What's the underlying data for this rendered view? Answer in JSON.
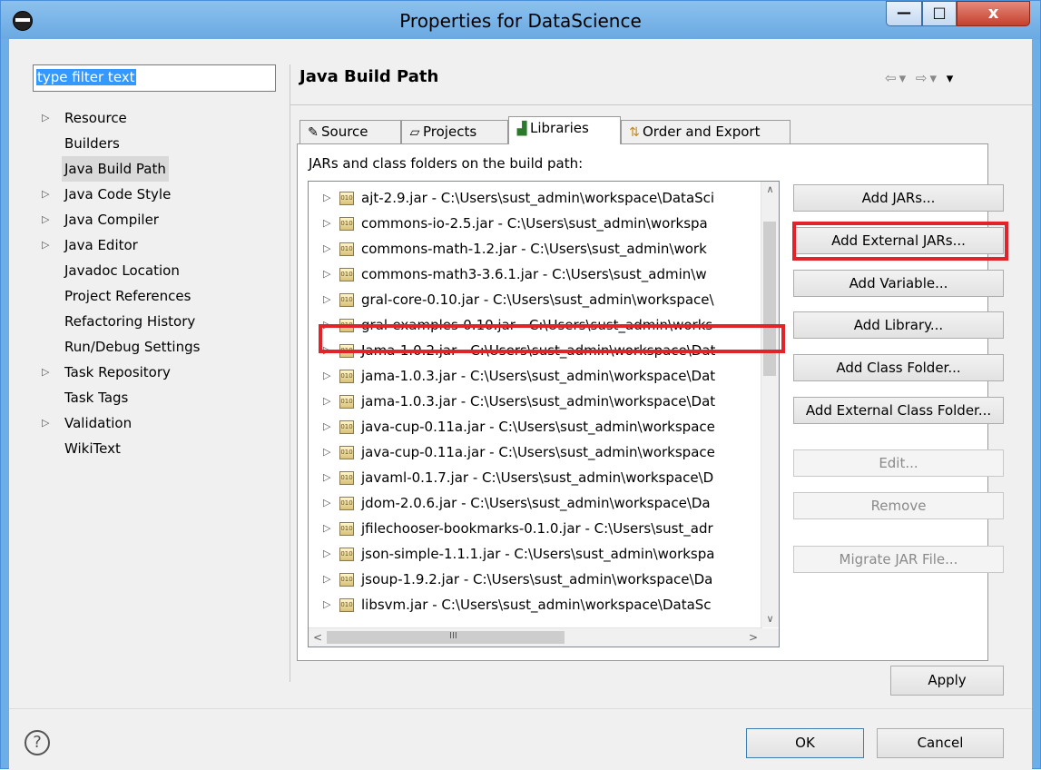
{
  "window": {
    "title": "Properties for DataScience",
    "controls": {
      "minimize": "—",
      "maximize": "□",
      "close": "x"
    }
  },
  "sidebar": {
    "filter_value": "type filter text",
    "items": [
      {
        "label": "Resource",
        "expandable": true
      },
      {
        "label": "Builders",
        "expandable": false
      },
      {
        "label": "Java Build Path",
        "expandable": false,
        "selected": true
      },
      {
        "label": "Java Code Style",
        "expandable": true
      },
      {
        "label": "Java Compiler",
        "expandable": true
      },
      {
        "label": "Java Editor",
        "expandable": true
      },
      {
        "label": "Javadoc Location",
        "expandable": false
      },
      {
        "label": "Project References",
        "expandable": false
      },
      {
        "label": "Refactoring History",
        "expandable": false
      },
      {
        "label": "Run/Debug Settings",
        "expandable": false
      },
      {
        "label": "Task Repository",
        "expandable": true
      },
      {
        "label": "Task Tags",
        "expandable": false
      },
      {
        "label": "Validation",
        "expandable": true
      },
      {
        "label": "WikiText",
        "expandable": false
      }
    ]
  },
  "page": {
    "title": "Java Build Path"
  },
  "tabs": [
    {
      "label": "Source",
      "icon": "source-folder-icon"
    },
    {
      "label": "Projects",
      "icon": "folder-icon"
    },
    {
      "label": "Libraries",
      "icon": "library-icon",
      "active": true
    },
    {
      "label": "Order and Export",
      "icon": "order-export-icon"
    }
  ],
  "libraries": {
    "label": "JARs and class folders on the build path:",
    "entries": [
      "ajt-2.9.jar - C:\\Users\\sust_admin\\workspace\\DataSci",
      "commons-io-2.5.jar - C:\\Users\\sust_admin\\workspa",
      "commons-math-1.2.jar - C:\\Users\\sust_admin\\work",
      "commons-math3-3.6.1.jar - C:\\Users\\sust_admin\\w",
      "gral-core-0.10.jar - C:\\Users\\sust_admin\\workspace\\",
      "gral-examples-0.10.jar - C:\\Users\\sust_admin\\works",
      "Jama-1.0.2.jar - C:\\Users\\sust_admin\\workspace\\Dat",
      "jama-1.0.3.jar - C:\\Users\\sust_admin\\workspace\\Dat",
      "jama-1.0.3.jar - C:\\Users\\sust_admin\\workspace\\Dat",
      "java-cup-0.11a.jar - C:\\Users\\sust_admin\\workspace",
      "java-cup-0.11a.jar - C:\\Users\\sust_admin\\workspace",
      "javaml-0.1.7.jar - C:\\Users\\sust_admin\\workspace\\D",
      "jdom-2.0.6.jar - C:\\Users\\sust_admin\\workspace\\Da",
      "jfilechooser-bookmarks-0.1.0.jar - C:\\Users\\sust_adr",
      "json-simple-1.1.1.jar - C:\\Users\\sust_admin\\workspa",
      "jsoup-1.9.2.jar - C:\\Users\\sust_admin\\workspace\\Da",
      "libsvm.jar - C:\\Users\\sust_admin\\workspace\\DataSc"
    ],
    "highlighted_index": 4,
    "jar_icon_text": "010",
    "hscroll_grip": "III"
  },
  "buttons": {
    "add_jars": "Add JARs...",
    "add_external_jars": "Add External JARs...",
    "add_variable": "Add Variable...",
    "add_library": "Add Library...",
    "add_class_folder": "Add Class Folder...",
    "add_external_class_folder": "Add External Class Folder...",
    "edit": "Edit...",
    "remove": "Remove",
    "migrate_jar": "Migrate JAR File...",
    "apply": "Apply",
    "ok": "OK",
    "cancel": "Cancel",
    "help": "?"
  },
  "colors": {
    "highlight": "#e0242a",
    "selection": "#3399ff",
    "titlebar": "#6aa9e2"
  }
}
